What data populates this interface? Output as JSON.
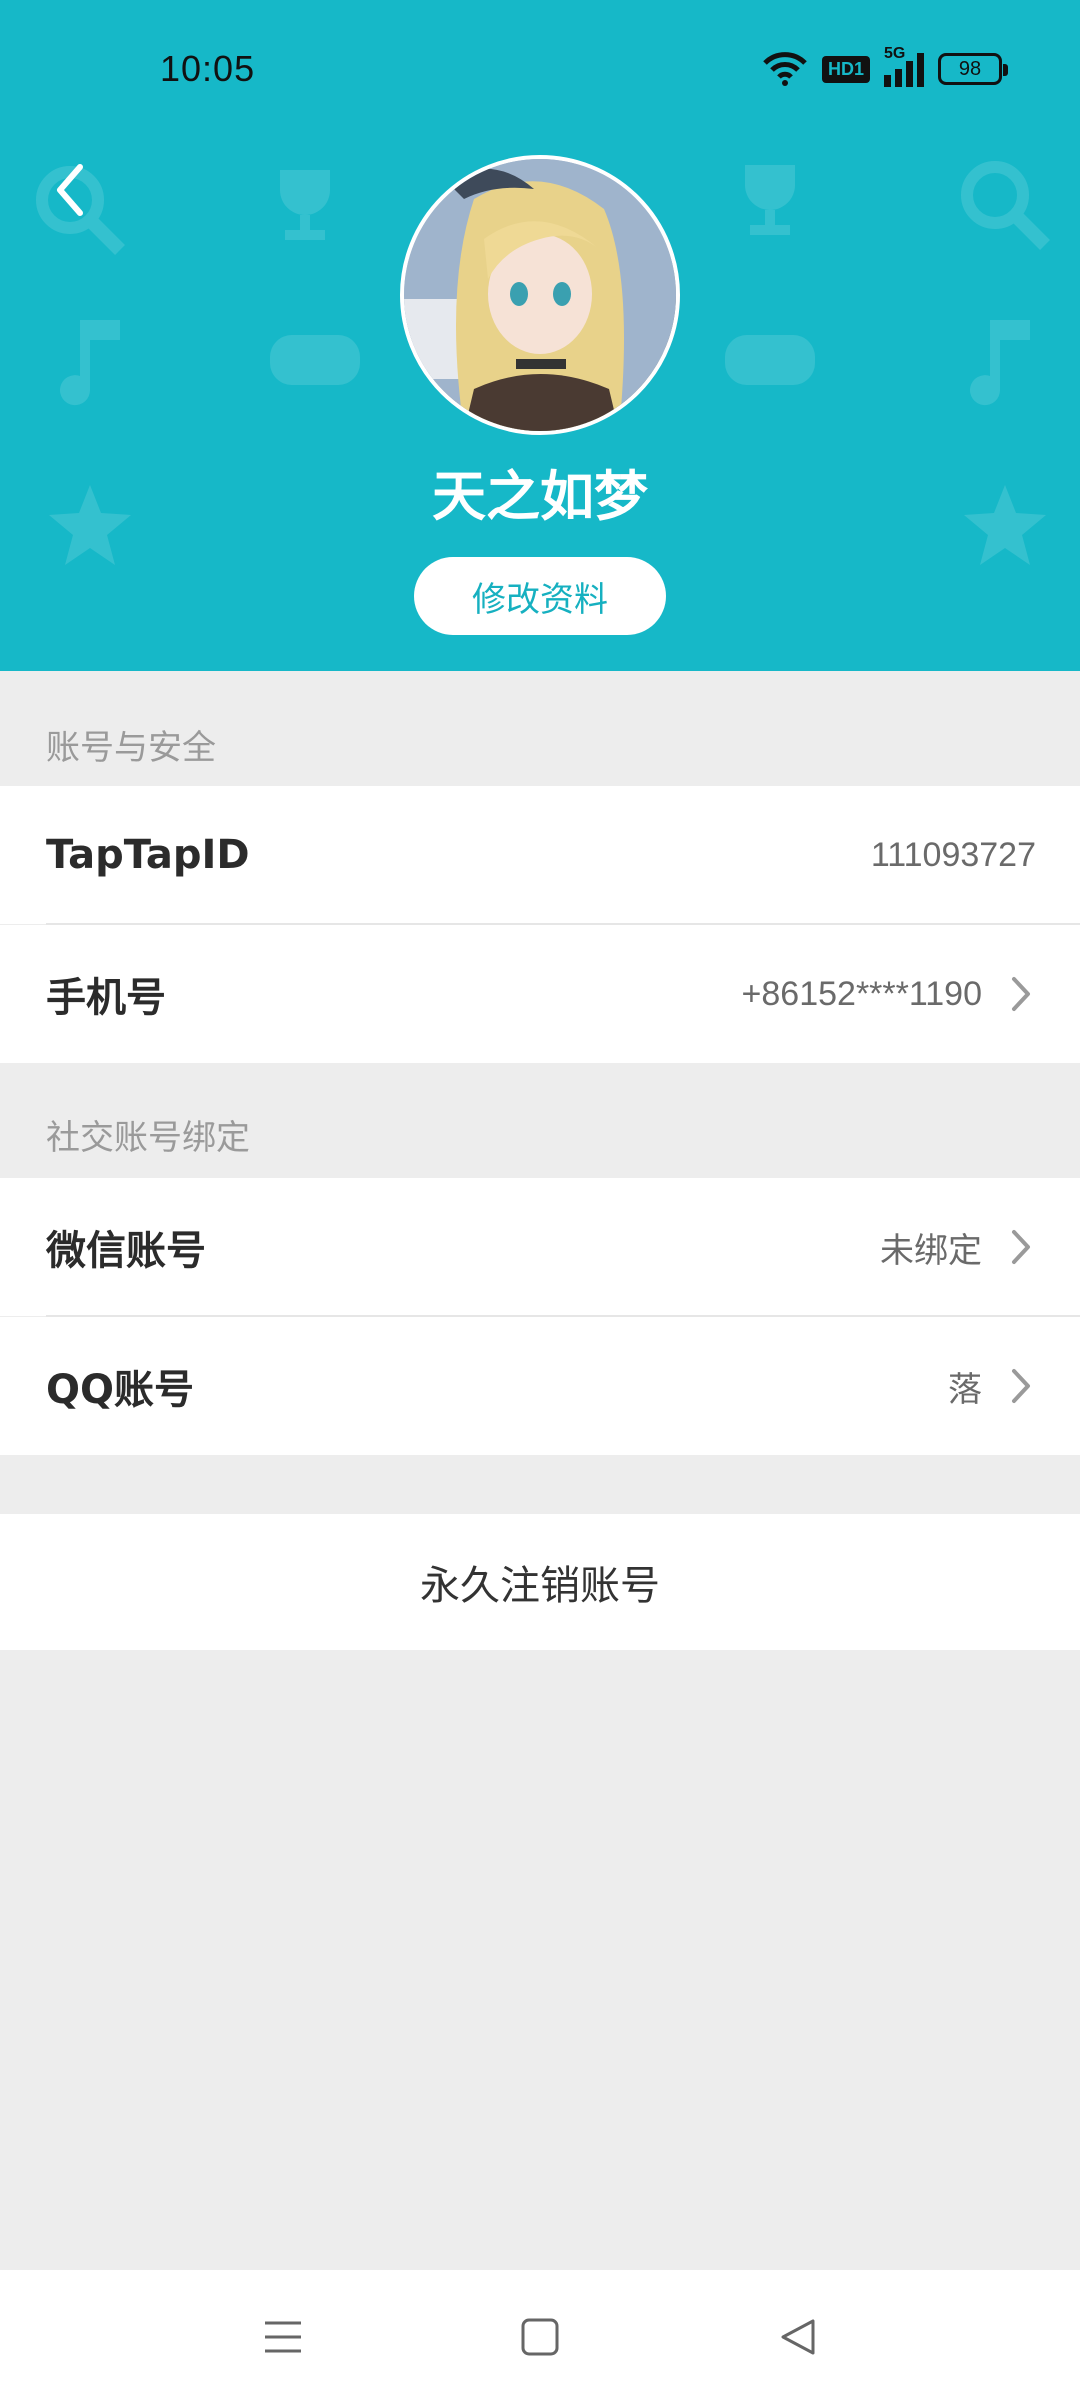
{
  "status_bar": {
    "time": "10:05",
    "network_badge": "HD1",
    "signal_label": "5G",
    "battery": "98"
  },
  "header": {
    "background_color": "#16b8c8",
    "username": "天之如梦",
    "edit_profile_label": "修改资料"
  },
  "account_security": {
    "section_title": "账号与安全",
    "rows": [
      {
        "label": "TapTapID",
        "value": "111093727"
      },
      {
        "label": "手机号",
        "value": "+86152****1190"
      }
    ]
  },
  "social_binding": {
    "section_title": "社交账号绑定",
    "rows": [
      {
        "label": "微信账号",
        "value": "未绑定"
      },
      {
        "label": "QQ账号",
        "value": "落"
      }
    ]
  },
  "delete_account_label": "永久注销账号",
  "icons": {
    "back": "back-arrow-icon",
    "chevron": "chevron-right-icon",
    "nav_menu": "menu-icon",
    "nav_home": "home-square-icon",
    "nav_back": "back-triangle-icon"
  }
}
